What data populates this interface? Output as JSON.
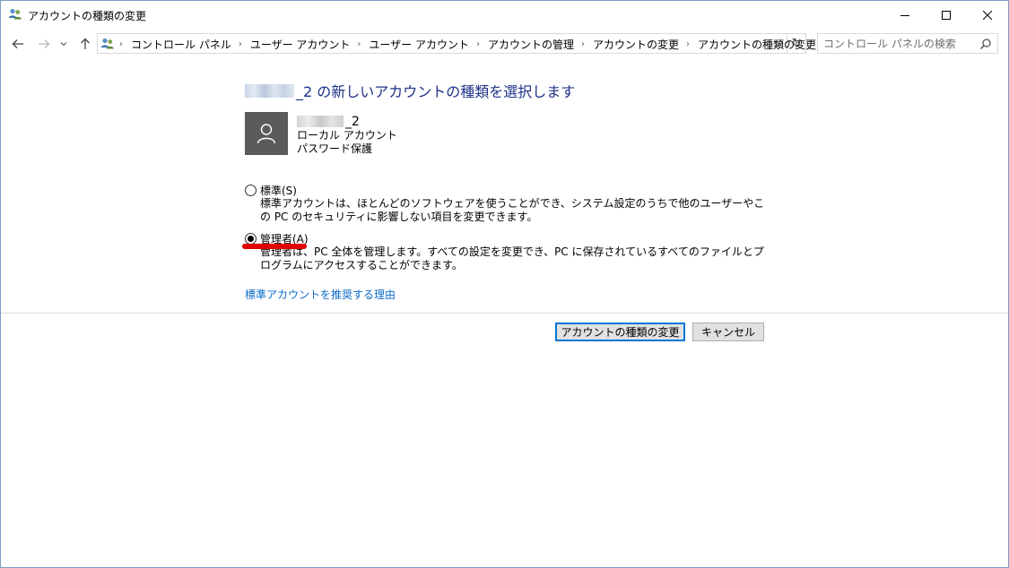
{
  "window": {
    "title": "アカウントの種類の変更"
  },
  "nav": {
    "breadcrumbs": [
      "コントロール パネル",
      "ユーザー アカウント",
      "ユーザー アカウント",
      "アカウントの管理",
      "アカウントの変更",
      "アカウントの種類の変更"
    ],
    "search_placeholder": "コントロール パネルの検索"
  },
  "main": {
    "heading_suffix": "_2 の新しいアカウントの種類を選択します",
    "user": {
      "name_suffix": "_2",
      "account_type": "ローカル アカウント",
      "protection": "パスワード保護"
    },
    "options": [
      {
        "label": "標準(S)",
        "description": "標準アカウントは、ほとんどのソフトウェアを使うことができ、システム設定のうちで他のユーザーやこの PC のセキュリティに影響しない項目を変更できます。",
        "selected": false
      },
      {
        "label": "管理者(A)",
        "description": "管理者は、PC 全体を管理します。すべての設定を変更でき、PC に保存されているすべてのファイルとプログラムにアクセスすることができます。",
        "selected": true
      }
    ],
    "reason_link": "標準アカウントを推奨する理由"
  },
  "buttons": {
    "change": "アカウントの種類の変更",
    "cancel": "キャンセル"
  },
  "colors": {
    "heading": "#1e3287",
    "link": "#0b6ac9",
    "annotation_underline": "#e20000",
    "button_focus": "#0078d7"
  }
}
